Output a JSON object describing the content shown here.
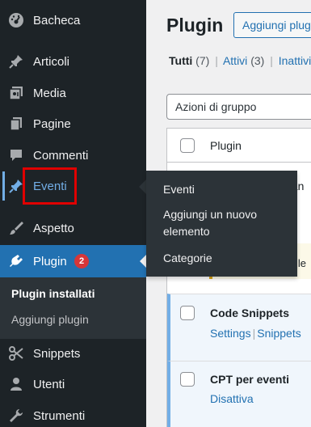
{
  "sidebar": {
    "items": [
      {
        "label": "Bacheca",
        "icon": "dashboard-icon"
      },
      {
        "label": "Articoli",
        "icon": "pin-icon"
      },
      {
        "label": "Media",
        "icon": "media-icon"
      },
      {
        "label": "Pagine",
        "icon": "pages-icon"
      },
      {
        "label": "Commenti",
        "icon": "comment-icon"
      },
      {
        "label": "Eventi",
        "icon": "pin-icon"
      },
      {
        "label": "Aspetto",
        "icon": "brush-icon"
      },
      {
        "label": "Plugin",
        "icon": "plugin-icon",
        "badge": "2"
      },
      {
        "label": "Snippets",
        "icon": "scissors-icon"
      },
      {
        "label": "Utenti",
        "icon": "user-icon"
      },
      {
        "label": "Strumenti",
        "icon": "wrench-icon"
      }
    ],
    "submenu": [
      {
        "label": "Plugin installati",
        "current": true
      },
      {
        "label": "Aggiungi plugin",
        "current": false
      }
    ]
  },
  "flyout": {
    "items": [
      "Eventi",
      "Aggiungi un nuovo\nelemento",
      "Categorie"
    ],
    "item_line1": "Aggiungi un nuovo",
    "item_line2": "elemento"
  },
  "main": {
    "title": "Plugin",
    "add_button": "Aggiungi plugin",
    "filters": {
      "all_label": "Tutti",
      "all_count": "(7)",
      "active_label": "Attivi",
      "active_count": "(3)",
      "inactive_label": "Inattivi"
    },
    "bulk_actions": "Azioni di gruppo",
    "table": {
      "column_plugin": "Plugin",
      "row1_partial_text": "pan",
      "row1_notice_partial": "ile",
      "rows": [
        {
          "name": "Code Snippets",
          "actions": [
            "Settings",
            "Snippets"
          ]
        },
        {
          "name": "CPT per eventi",
          "actions": [
            "Disattiva"
          ]
        }
      ]
    }
  },
  "colors": {
    "sidebar_bg": "#1d2327",
    "submenu_bg": "#2c3338",
    "accent": "#2271b1",
    "highlight_link": "#72aee6",
    "badge": "#d63638",
    "annotation_box": "#e00000"
  }
}
